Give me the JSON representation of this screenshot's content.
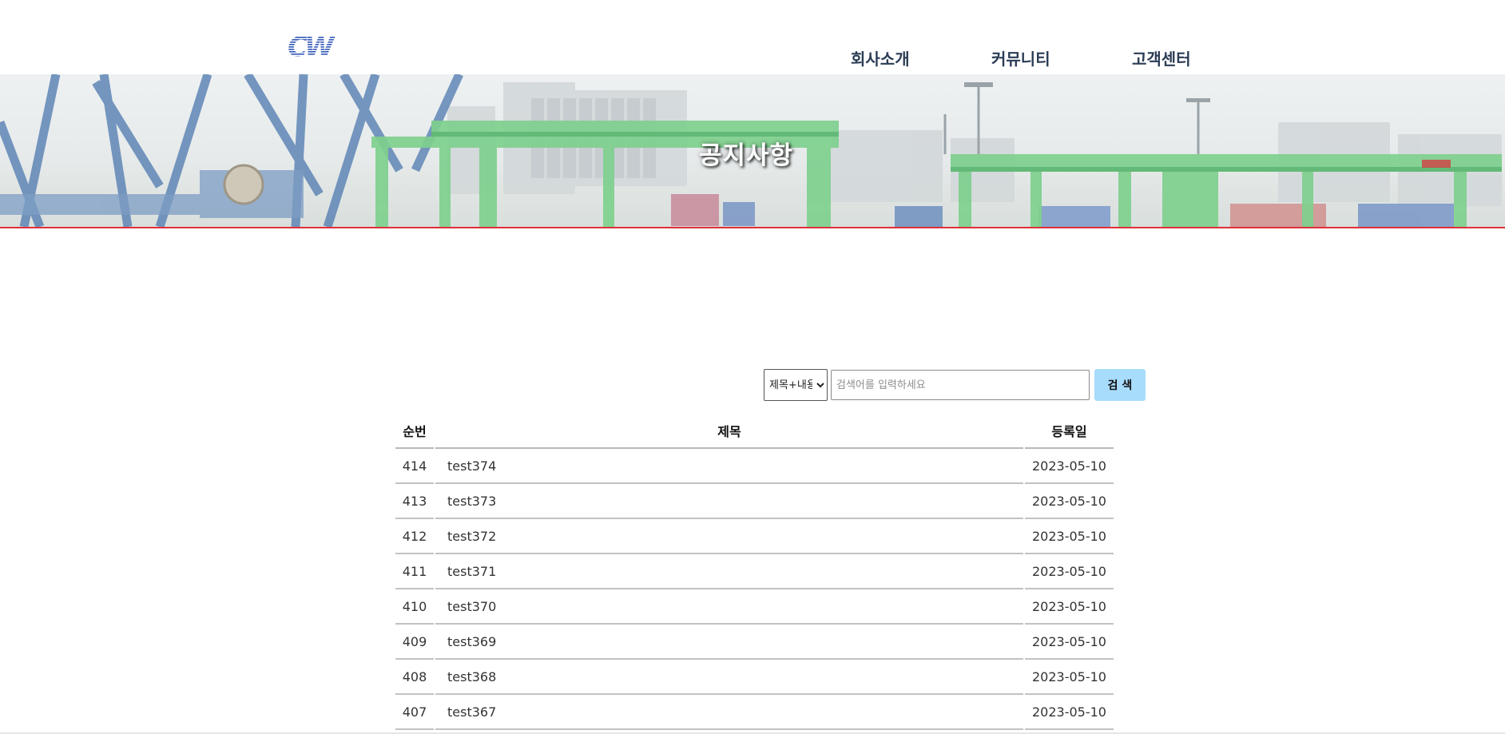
{
  "header": {
    "logo_alt": "CW",
    "nav": [
      {
        "label": "회사소개"
      },
      {
        "label": "커뮤니티"
      },
      {
        "label": "고객센터"
      }
    ]
  },
  "banner": {
    "title": "공지사항"
  },
  "search": {
    "select_value": "제목+내용",
    "placeholder": "검색어를 입력하세요",
    "button_label": "검 색"
  },
  "table": {
    "headers": {
      "no": "순번",
      "title": "제목",
      "date": "등록일"
    },
    "rows": [
      {
        "no": "414",
        "title": "test374",
        "date": "2023-05-10"
      },
      {
        "no": "413",
        "title": "test373",
        "date": "2023-05-10"
      },
      {
        "no": "412",
        "title": "test372",
        "date": "2023-05-10"
      },
      {
        "no": "411",
        "title": "test371",
        "date": "2023-05-10"
      },
      {
        "no": "410",
        "title": "test370",
        "date": "2023-05-10"
      },
      {
        "no": "409",
        "title": "test369",
        "date": "2023-05-10"
      },
      {
        "no": "408",
        "title": "test368",
        "date": "2023-05-10"
      },
      {
        "no": "407",
        "title": "test367",
        "date": "2023-05-10"
      }
    ]
  },
  "colors": {
    "nav_text": "#2b3d55",
    "banner_border": "#e0303a",
    "search_button": "#a7dcfc",
    "crane_green": "#7fd08e",
    "crane_blue": "#5f86b6"
  }
}
